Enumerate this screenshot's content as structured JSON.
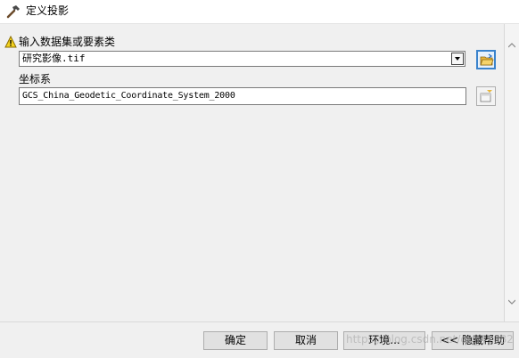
{
  "window": {
    "title": "定义投影",
    "title_icon": "hammer-icon"
  },
  "form": {
    "input_label": "输入数据集或要素类",
    "input_value": "研究影像.tif",
    "input_warning_icon": "warning-icon",
    "input_browse_icon": "folder-open-icon",
    "crs_label": "坐标系",
    "crs_value": "GCS_China_Geodetic_Coordinate_System_2000",
    "crs_button_icon": "spatial-reference-properties-icon"
  },
  "buttons": {
    "ok": "确定",
    "cancel": "取消",
    "env": "环境...",
    "hide_help": "<< 隐藏帮助"
  },
  "watermark": "https://blog.csdn.net/qq_41082",
  "colors": {
    "active_border": "#3a83cc",
    "dialog_bg": "#f0f0f0",
    "warning": "#f3d21f"
  }
}
